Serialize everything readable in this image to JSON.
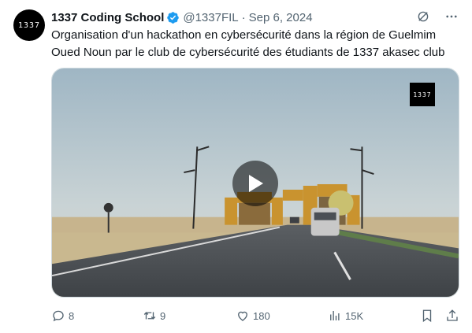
{
  "avatar": {
    "text": "1337"
  },
  "author": {
    "name": "1337 Coding School",
    "handle": "@1337FIL",
    "separator": "·",
    "date": "Sep 6, 2024"
  },
  "post": {
    "text": "Organisation d'un hackathon en cybersécurité dans la région de Guelmim Oued Noun par le club de cybersécurité des étudiants de 1337 akasec club"
  },
  "media": {
    "watermark": "1337"
  },
  "actions": {
    "replies": "8",
    "reposts": "9",
    "likes": "180",
    "views": "15K"
  },
  "colors": {
    "verified": "#1d9bf0",
    "muted": "#536471",
    "text": "#0f1419"
  },
  "icons": [
    "verified-badge-icon",
    "grok-icon",
    "more-icon",
    "play-icon",
    "reply-icon",
    "repost-icon",
    "like-icon",
    "views-icon",
    "bookmark-icon",
    "share-icon"
  ]
}
